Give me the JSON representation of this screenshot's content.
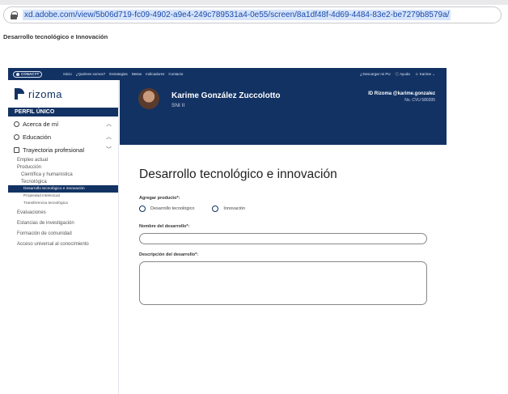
{
  "browser": {
    "url": "xd.adobe.com/view/5b06d719-fc09-4902-a9e4-249c789531a4-0e55/screen/8a1df48f-4d69-4484-83e2-be7279b8579a/"
  },
  "document": {
    "title": "Desarrollo tecnológico e Innovación"
  },
  "topnav": {
    "logo": "CONACYT",
    "links": [
      "Inicio",
      "¿Quiénes somos?",
      "Estrategias",
      "Metas",
      "Indicadores",
      "Contacto"
    ],
    "download": "Descargar mi PU",
    "help": "Ayuda",
    "user": "Karime"
  },
  "sidebar": {
    "brand": "rizoma",
    "perfil": "PERFIL ÚNICO",
    "sections": {
      "acerca": "Acerca de mí",
      "educacion": "Educación",
      "trayectoria": "Trayectoria profesional"
    },
    "items": {
      "empleo": "Empleo actual",
      "produccion": "Producción",
      "cientifica": "Científica y humanística",
      "tecnologica": "Tecnológica",
      "desarrollo": "Desarrollo tecnológico e innovación",
      "propiedad": "Propiedad intelectual",
      "transferencia": "Transferencia tecnológica",
      "evaluaciones": "Evaluaciones",
      "estancias": "Estancias de investigación",
      "formacion": "Formación de comunidad",
      "acceso": "Acceso universal al conocimiento"
    }
  },
  "header": {
    "name": "Karime González Zuccolotto",
    "level": "SNI II",
    "id": "ID Rizoma @karime.gonzalez",
    "cvu": "No. CVU 580395"
  },
  "main": {
    "title": "Desarrollo tecnológico e innovación",
    "agregar_label": "Agregar producto*:",
    "option_1": "Desarrollo tecnológico",
    "option_2": "Innovación",
    "nombre_label": "Nombre del desarrollo*:",
    "descripcion_label": "Descripción del desarrollo*:"
  }
}
